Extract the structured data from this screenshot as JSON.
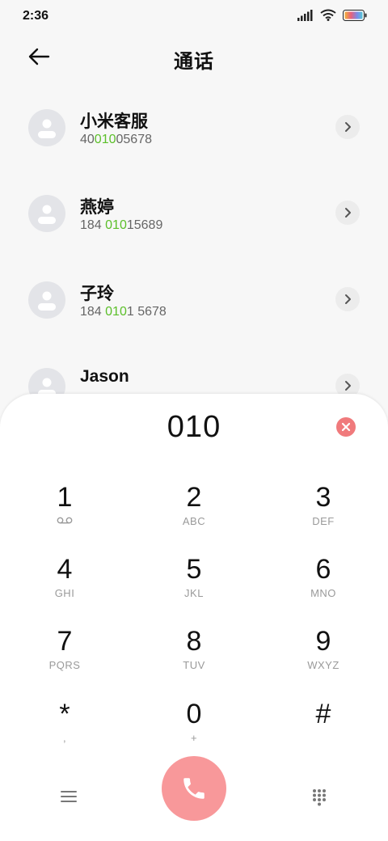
{
  "status_bar": {
    "time": "2:36",
    "battery_colors": [
      "#f2b13a",
      "#e8607a",
      "#7a8be8",
      "#57c7d6"
    ]
  },
  "header": {
    "title": "通话"
  },
  "contacts": [
    {
      "name": "小米客服",
      "number_pre": "40",
      "number_hl": "010",
      "number_post": "05678"
    },
    {
      "name": "燕婷",
      "number_pre": "184 ",
      "number_hl": "010",
      "number_post": "15689"
    },
    {
      "name": "子玲",
      "number_pre": "184 ",
      "number_hl": "010",
      "number_post": "1 5678"
    },
    {
      "name": "Jason",
      "number_pre": "",
      "number_hl": "",
      "number_post": ""
    }
  ],
  "dialer": {
    "input": "010",
    "keys": [
      {
        "digit": "1",
        "letters": ""
      },
      {
        "digit": "2",
        "letters": "ABC"
      },
      {
        "digit": "3",
        "letters": "DEF"
      },
      {
        "digit": "4",
        "letters": "GHI"
      },
      {
        "digit": "5",
        "letters": "JKL"
      },
      {
        "digit": "6",
        "letters": "MNO"
      },
      {
        "digit": "7",
        "letters": "PQRS"
      },
      {
        "digit": "8",
        "letters": "TUV"
      },
      {
        "digit": "9",
        "letters": "WXYZ"
      },
      {
        "digit": "*",
        "letters": ","
      },
      {
        "digit": "0",
        "letters": "+"
      },
      {
        "digit": "#",
        "letters": ""
      }
    ]
  },
  "colors": {
    "highlight": "#5cbf2a",
    "call_button": "#f8989a",
    "clear_button": "#f07a7c"
  },
  "icons": {
    "back": "arrow-left-icon",
    "chevron": "chevron-right-icon",
    "voicemail": "voicemail-icon",
    "clear": "close-icon",
    "menu": "menu-icon",
    "call": "phone-icon",
    "dialpad": "dialpad-icon"
  }
}
